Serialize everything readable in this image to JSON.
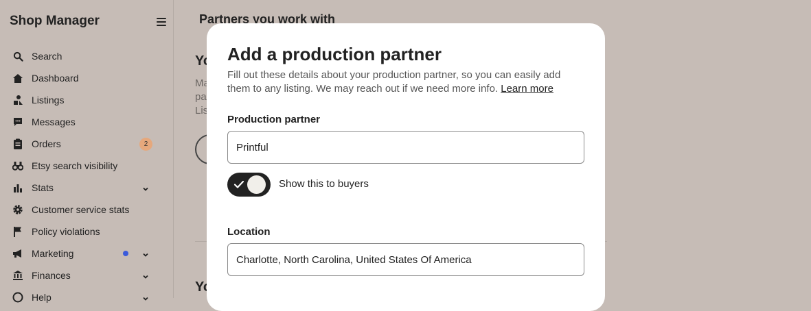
{
  "sidebar": {
    "brand": "Shop Manager",
    "items": [
      {
        "label": "Search",
        "icon": "search-icon"
      },
      {
        "label": "Dashboard",
        "icon": "home-icon"
      },
      {
        "label": "Listings",
        "icon": "listings-icon"
      },
      {
        "label": "Messages",
        "icon": "message-icon"
      },
      {
        "label": "Orders",
        "icon": "clipboard-icon",
        "badge": "2"
      },
      {
        "label": "Etsy search visibility",
        "icon": "binoculars-icon"
      },
      {
        "label": "Stats",
        "icon": "bar-chart-icon"
      },
      {
        "label": "Customer service stats",
        "icon": "gear-icon"
      },
      {
        "label": "Policy violations",
        "icon": "flag-icon"
      },
      {
        "label": "Marketing",
        "icon": "megaphone-icon"
      },
      {
        "label": "Finances",
        "icon": "bank-icon"
      },
      {
        "label": "Help",
        "icon": "help-icon"
      }
    ]
  },
  "main": {
    "title": "Partners you work with",
    "fragments": [
      "Yo",
      "Ma",
      "pa",
      "Lis",
      "Yo"
    ]
  },
  "modal": {
    "title": "Add a production partner",
    "description": "Fill out these details about your production partner, so you can easily add them to any listing. We may reach out if we need more info.",
    "learn_more": "Learn more",
    "partner_label": "Production partner",
    "partner_value": "Printful",
    "toggle_label": "Show this to buyers",
    "toggle_on": true,
    "location_label": "Location",
    "location_value": "Charlotte, North Carolina, United States Of America"
  },
  "colors": {
    "accent": "#222222",
    "badge": "#e6a87c",
    "notification_dot": "#3b5bdb",
    "overlay": "#c6bcb6"
  }
}
